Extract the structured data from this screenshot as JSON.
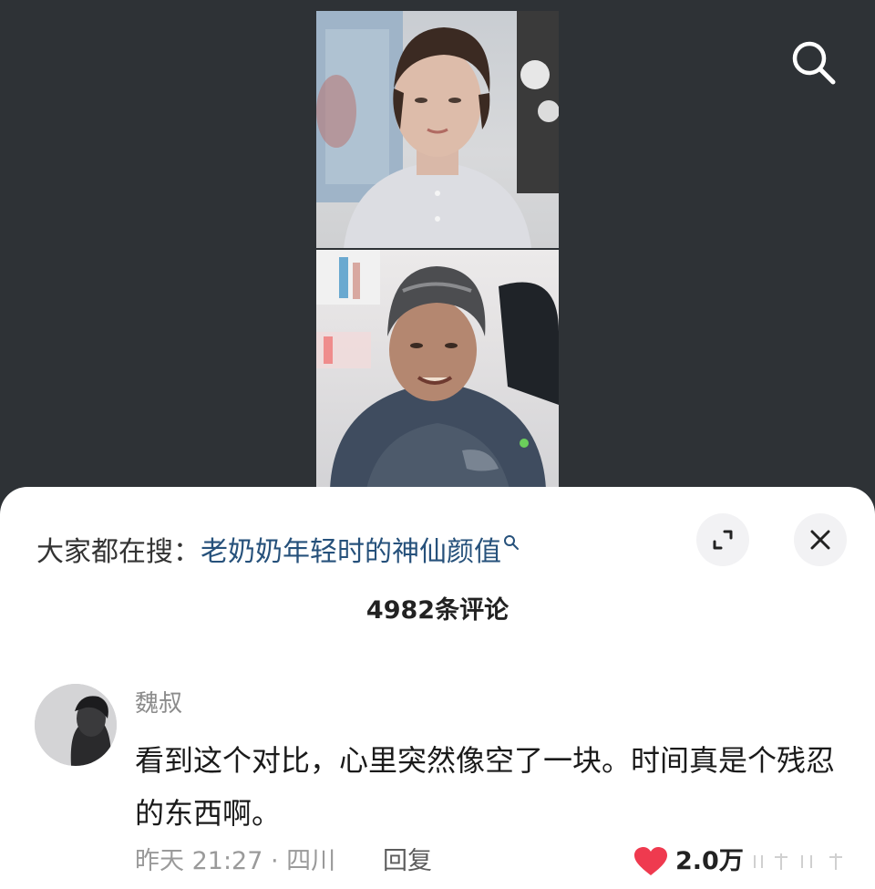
{
  "colors": {
    "video_background": "#2e3236",
    "sheet_background": "#ffffff",
    "search_term": "#26517b",
    "like_heart": "#ef3a4f",
    "meta_gray": "#9a9a9a"
  },
  "video": {
    "images": [
      {
        "name": "young-woman-portrait"
      },
      {
        "name": "elderly-woman-portrait"
      }
    ],
    "search_icon": "search-icon"
  },
  "sheet": {
    "search_prefix": "大家都在搜：",
    "search_term": "老奶奶年轻时的神仙颜值",
    "search_term_icon": "search-small-icon",
    "expand_icon": "expand-icon",
    "close_icon": "close-icon",
    "comment_count": "4982条评论"
  },
  "comment": {
    "username": "魏叔",
    "text": "看到这个对比，心里突然像空了一块。时间真是个残忍的东西啊。",
    "meta": "昨天 21:27 · 四川",
    "reply_label": "回复",
    "like_icon": "heart-icon",
    "like_count": "2.0万"
  }
}
